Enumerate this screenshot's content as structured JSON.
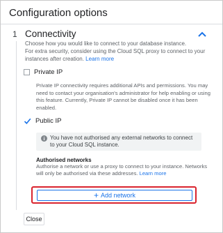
{
  "panel": {
    "title": "Configuration options"
  },
  "step": {
    "number": "1",
    "title": "Connectivity",
    "collapse_icon": "chevron-up-icon",
    "description_line1": "Choose how you would like to connect to your database instance.",
    "description_line2": "For extra security, consider using the Cloud SQL proxy to connect to your instances after creation.",
    "learn_more_label": "Learn more"
  },
  "private_ip": {
    "label": "Private IP",
    "checked": false,
    "description": "Private IP connectivity requires additional APIs and permissions. You may need to contact your organisation's administrator for help enabling or using this feature. Currently, Private IP cannot be disabled once it has been enabled."
  },
  "public_ip": {
    "label": "Public IP",
    "checked": true,
    "notice_icon": "info-icon",
    "notice_text": "You have not authorised any external networks to connect to your Cloud SQL instance.",
    "authorised_title": "Authorised networks",
    "authorised_desc": "Authorise a network or use a proxy to connect to your instance. Networks will only be authorised via these addresses.",
    "learn_more_label": "Learn more",
    "add_network_label": "Add network"
  },
  "footer": {
    "close_label": "Close"
  },
  "colors": {
    "accent": "#1a73e8",
    "highlight": "#d9232e"
  }
}
